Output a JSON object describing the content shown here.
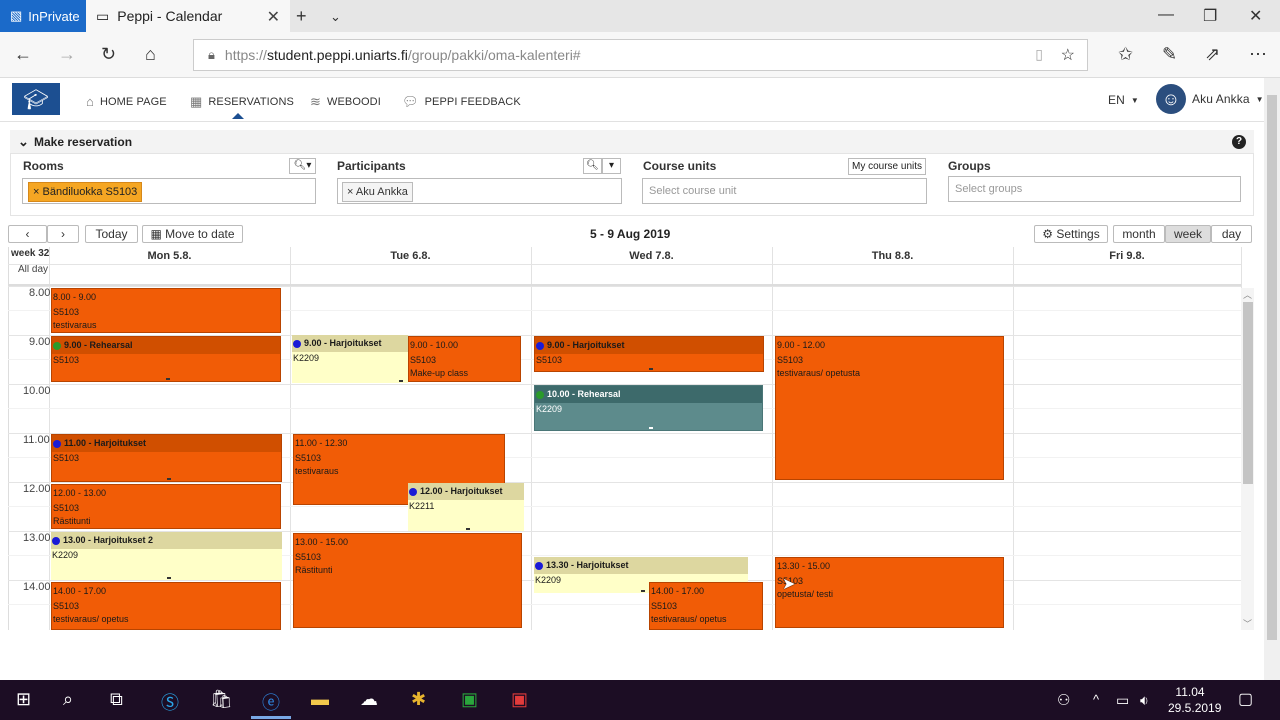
{
  "browser": {
    "inprivate_label": "InPrivate",
    "tab_title": "Peppi - Calendar",
    "url_prefix": "https://",
    "url_domain": "student.peppi.uniarts.fi",
    "url_path": "/group/pakki/oma-kalenteri#"
  },
  "nav": {
    "items": [
      {
        "label": "HOME PAGE",
        "icon": "home-icon"
      },
      {
        "label": "RESERVATIONS",
        "icon": "calendar-icon"
      },
      {
        "label": "WEBOODI",
        "icon": "database-icon"
      },
      {
        "label": "PEPPI FEEDBACK",
        "icon": "chat-icon"
      }
    ],
    "language": "EN",
    "user": "Aku Ankka"
  },
  "reservation": {
    "title": "Make reservation",
    "rooms_label": "Rooms",
    "rooms_chip": "Bändiluokka S5103",
    "participants_label": "Participants",
    "participants_chip": "Aku Ankka",
    "courses_label": "Course units",
    "courses_button": "My course units",
    "courses_placeholder": "Select course unit",
    "groups_label": "Groups",
    "groups_placeholder": "Select groups"
  },
  "toolbar": {
    "today": "Today",
    "move_to_date": "Move to date",
    "range": "5 - 9 Aug 2019",
    "settings": "Settings",
    "view_month": "month",
    "view_week": "week",
    "view_day": "day",
    "active_view": "week"
  },
  "calendar": {
    "week_label": "week 32",
    "allday_label": "All day",
    "days": [
      "Mon 5.8.",
      "Tue 6.8.",
      "Wed 7.8.",
      "Thu 8.8.",
      "Fri 9.8."
    ],
    "hours": [
      "8.00",
      "9.00",
      "10.00",
      "11.00",
      "12.00",
      "13.00",
      "14.00"
    ],
    "events": [
      {
        "time": "8.00 - 9.00",
        "l2": "S5103",
        "l3": "testivaraus"
      },
      {
        "time": "9.00 - Rehearsal",
        "l2": "S5103"
      },
      {
        "time": "11.00 - Harjoitukset",
        "l2": "S5103"
      },
      {
        "time": "12.00 - 13.00",
        "l2": "S5103",
        "l3": "Rästitunti"
      },
      {
        "time": "13.00 - Harjoitukset 2",
        "l2": "K2209"
      },
      {
        "time": "14.00 - 17.00",
        "l2": "S5103",
        "l3": "testivaraus/ opetus"
      },
      {
        "time": "9.00 - Harjoitukset",
        "l2": "K2209"
      },
      {
        "time": "9.00 - 10.00",
        "l2": "S5103",
        "l3": "Make-up class"
      },
      {
        "time": "11.00 - 12.30",
        "l2": "S5103",
        "l3": "testivaraus"
      },
      {
        "time": "12.00 - Harjoitukset",
        "l2": "K2211"
      },
      {
        "time": "13.00 - 15.00",
        "l2": "S5103",
        "l3": "Rästitunti"
      },
      {
        "time": "9.00 - Harjoitukset",
        "l2": "S5103"
      },
      {
        "time": "10.00 - Rehearsal",
        "l2": "K2209"
      },
      {
        "time": "13.30 - Harjoitukset",
        "l2": "K2209"
      },
      {
        "time": "14.00 - 17.00",
        "l2": "S5103",
        "l3": "testivaraus/ opetus"
      },
      {
        "time": "9.00 - 12.00",
        "l2": "S5103",
        "l3": "testivaraus/ opetusta"
      },
      {
        "time": "13.30 - 15.00",
        "l2": "S5103",
        "l3": "opetusta/ testi"
      }
    ]
  },
  "taskbar": {
    "time": "11.04",
    "date": "29.5.2019"
  },
  "colors": {
    "accent": "#1c4f91",
    "event": "#f15c06",
    "event_header": "#d04f00",
    "pending": "#ffffc8",
    "pending_header": "#ddd7a0",
    "teal": "#5d8b8c"
  }
}
